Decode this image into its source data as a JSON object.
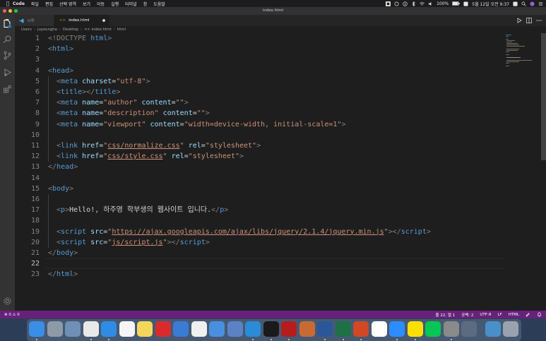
{
  "menubar": {
    "app_name": "Code",
    "items": [
      "파일",
      "편집",
      "선택 영역",
      "보기",
      "이동",
      "실행",
      "터미널",
      "창",
      "도움말"
    ],
    "battery": "100%",
    "datetime": "5월 12일 오전 9:37"
  },
  "window": {
    "title": "index.html"
  },
  "tabs": [
    {
      "label": "시작"
    },
    {
      "label": "index.html"
    }
  ],
  "breadcrumb": [
    "Users",
    "juyoungha",
    "Desktop",
    "<> index.html",
    "html"
  ],
  "editor": {
    "lines": [
      {
        "n": "1"
      },
      {
        "n": "2"
      },
      {
        "n": "3"
      },
      {
        "n": "4"
      },
      {
        "n": "5"
      },
      {
        "n": "6"
      },
      {
        "n": "7"
      },
      {
        "n": "8"
      },
      {
        "n": "9"
      },
      {
        "n": "10"
      },
      {
        "n": "11"
      },
      {
        "n": "12"
      },
      {
        "n": "13"
      },
      {
        "n": "14"
      },
      {
        "n": "15"
      },
      {
        "n": "16"
      },
      {
        "n": "17"
      },
      {
        "n": "18"
      },
      {
        "n": "19"
      },
      {
        "n": "20"
      },
      {
        "n": "21"
      },
      {
        "n": "22"
      },
      {
        "n": "23"
      }
    ],
    "code": {
      "l1": [
        "<!DOCTYPE",
        " html",
        ">"
      ],
      "l2": [
        "<",
        "html",
        ">"
      ],
      "l4": [
        "<",
        "head",
        ">"
      ],
      "l5": [
        "<",
        "meta",
        " charset",
        "=",
        "\"utf-8\"",
        ">"
      ],
      "l6": [
        "<",
        "title",
        "></",
        "title",
        ">"
      ],
      "l7": [
        "<",
        "meta",
        " name",
        "=",
        "\"author\"",
        " content",
        "=",
        "\"\"",
        ">"
      ],
      "l8": [
        "<",
        "meta",
        " name",
        "=",
        "\"description\"",
        " content",
        "=",
        "\"\"",
        ">"
      ],
      "l9": [
        "<",
        "meta",
        " name",
        "=",
        "\"viewport\"",
        " content",
        "=",
        "\"width=device-width, initial-scale=1\"",
        ">"
      ],
      "l11": [
        "<",
        "link",
        " href",
        "=",
        "\"",
        "css/normalize.css",
        "\"",
        " rel",
        "=",
        "\"stylesheet\"",
        ">"
      ],
      "l12": [
        "<",
        "link",
        " href",
        "=",
        "\"",
        "css/style.css",
        "\"",
        " rel",
        "=",
        "\"stylesheet\"",
        ">"
      ],
      "l13": [
        "</",
        "head",
        ">"
      ],
      "l15": [
        "<",
        "body",
        ">"
      ],
      "l17": [
        "<",
        "p",
        ">",
        "Hello!, 하주영 학부생의 웹사이트 입니다.",
        "</",
        "p",
        ">"
      ],
      "l19": [
        "<",
        "script",
        " src",
        "=",
        "\"",
        "https://ajax.googleapis.com/ajax/libs/jquery/2.1.4/jquery.min.js",
        "\"",
        "></",
        "script",
        ">"
      ],
      "l20": [
        "<",
        "script",
        " src",
        "=",
        "\"",
        "js/script.js",
        "\"",
        "></",
        "script",
        ">"
      ],
      "l21": [
        "</",
        "body",
        ">"
      ],
      "l23": [
        "</",
        "html",
        ">"
      ]
    }
  },
  "statusbar": {
    "problems": "⊗ 0 ⚠ 0",
    "position": "줄 22, 열 1",
    "spaces": "공백: 2",
    "encoding": "UTF-8",
    "eol": "LF",
    "language": "HTML"
  },
  "dock": {
    "apps": [
      "finder-icon",
      "launchpad-icon",
      "preview-icon",
      "chrome-icon",
      "safari-icon",
      "calendar-icon",
      "notes-icon",
      "scrobbles-icon",
      "pencil-icon",
      "reminders-icon",
      "xcode-icon",
      "keynote-icon",
      "vscode-icon",
      "terminal-icon",
      "filezilla-icon",
      "macos-icon",
      "word-icon",
      "excel-icon",
      "powerpoint-icon",
      "sheets-icon",
      "zoom-icon",
      "kakaotalk-icon",
      "line-icon",
      "settings-icon",
      "display-icon",
      "downloads-icon",
      "trash-icon"
    ],
    "colors": [
      "#3a8ee6",
      "#8e9aa8",
      "#6f8fb6",
      "#e8e8e8",
      "#2e8ce6",
      "#f5f5f5",
      "#f4d75a",
      "#d92b2b",
      "#3a7bd5",
      "#f0f0f0",
      "#4a8fdf",
      "#5b82c4",
      "#2c8bd6",
      "#1a1a1a",
      "#b71c1c",
      "#c86b33",
      "#2b579a",
      "#1e7145",
      "#d24726",
      "#ffffff",
      "#2d8cff",
      "#f9e000",
      "#06c755",
      "#8a8a8a",
      "#5d6b80",
      "#4a90c8",
      "#9aa3ad"
    ]
  }
}
